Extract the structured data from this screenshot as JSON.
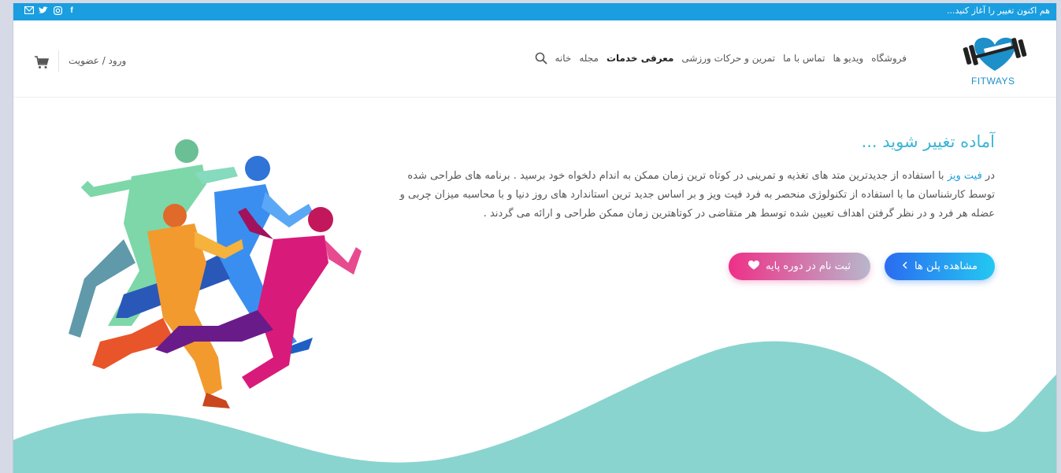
{
  "topbar": {
    "message": "هم اکنون تغییر را آغاز کنید...",
    "social_icons": [
      "mail-icon",
      "twitter-icon",
      "instagram-icon",
      "facebook-icon"
    ]
  },
  "logo": {
    "text": "FITWAYS"
  },
  "nav": {
    "items": [
      {
        "label": "خانه"
      },
      {
        "label": "مجله"
      },
      {
        "label": "معرفی خدمات"
      },
      {
        "label": "تمرین و حرکات ورزشی"
      },
      {
        "label": "تماس با ما"
      },
      {
        "label": "ویدیو ها"
      },
      {
        "label": "فروشگاه"
      }
    ]
  },
  "account": {
    "login_label": "ورود / عضویت"
  },
  "hero": {
    "title": "آماده تغییر شوید ...",
    "link_text": "فیت ویز",
    "intro_prefix": "در ",
    "body": " با استفاده از جدیدترین متد های تغذیه و تمرینی در کوتاه ترین زمان ممکن به اندام دلخواه خود برسید . برنامه های طراحی شده توسط کارشناسان ما با استفاده از تکنولوژی منحصر به فرد فیت ویز و بر اساس جدید ترین استاندارد های روز دنیا و با محاسبه میزان چربی و عضله هر فرد و در نظر گرفتن اهداف تعیین شده توسط هر متقاضی در کوتاهترین زمان ممکن طراحی و ارائه می گردند .",
    "btn_plans": "مشاهده پلن ها",
    "btn_register": "ثبت نام در دوره پایه"
  },
  "colors": {
    "topbar": "#1a9ee0",
    "title": "#3bb5d6",
    "wave": "#8ad4cf"
  }
}
